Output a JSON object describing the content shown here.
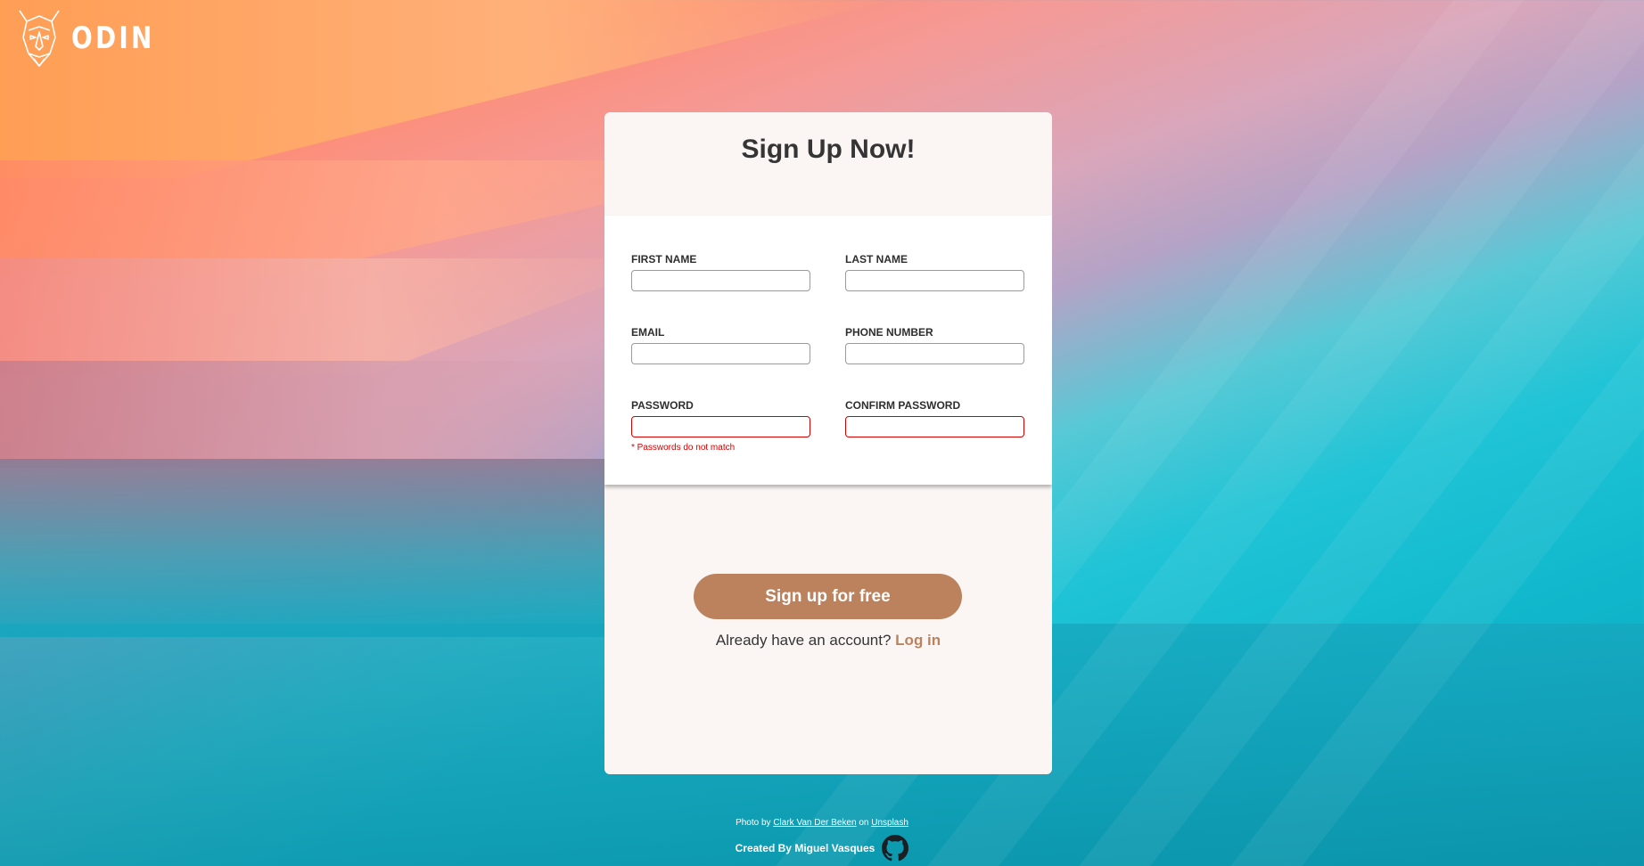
{
  "brand": {
    "name": "ODIN",
    "logo_icon": "viking-helmet-icon"
  },
  "form": {
    "title": "Sign Up Now!",
    "fields": {
      "first_name": {
        "label": "FIRST NAME",
        "value": ""
      },
      "last_name": {
        "label": "LAST NAME",
        "value": ""
      },
      "email": {
        "label": "EMAIL",
        "value": ""
      },
      "phone": {
        "label": "PHONE NUMBER",
        "value": ""
      },
      "password": {
        "label": "PASSWORD",
        "value": ""
      },
      "confirm_password": {
        "label": "CONFIRM PASSWORD",
        "value": ""
      }
    },
    "error": "* Passwords do not match",
    "submit_label": "Sign up for free",
    "login_prompt": "Already have an account?",
    "login_link": "Log in"
  },
  "footer": {
    "photo_by": "Photo by",
    "photographer": "Clark Van Der Beken",
    "on": "on",
    "source": "Unsplash",
    "created_by": "Created By Miguel Vasques",
    "github_icon": "github-icon"
  },
  "colors": {
    "accent": "#bc825e",
    "error": "#d40000",
    "card_bg": "#fbf6f4",
    "title": "#353535"
  }
}
